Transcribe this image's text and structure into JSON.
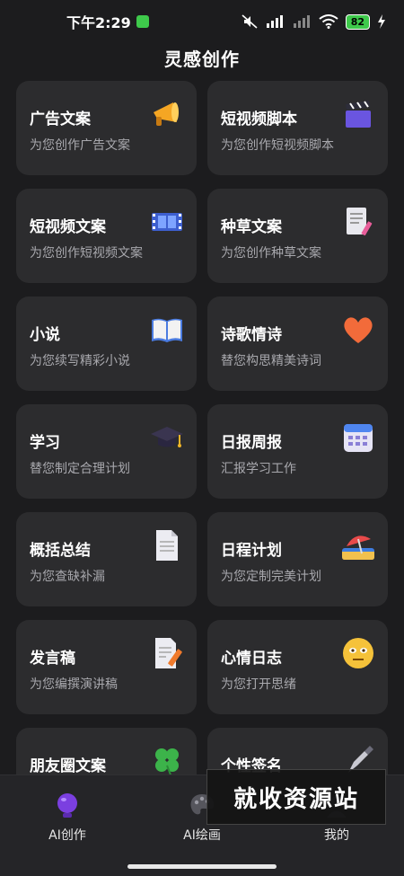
{
  "status_bar": {
    "time": "下午2:29",
    "battery": "82",
    "icons": [
      "mute-icon",
      "hd-signal-icon",
      "signal-icon",
      "wifi-icon",
      "battery-icon",
      "charging-icon"
    ]
  },
  "header": {
    "title": "灵感创作"
  },
  "cards": [
    {
      "title": "广告文案",
      "desc": "为您创作广告文案",
      "icon": "megaphone-icon"
    },
    {
      "title": "短视频脚本",
      "desc": "为您创作短视频脚本",
      "icon": "clapperboard-icon"
    },
    {
      "title": "短视频文案",
      "desc": "为您创作短视频文案",
      "icon": "film-strip-icon"
    },
    {
      "title": "种草文案",
      "desc": "为您创作种草文案",
      "icon": "document-pen-icon"
    },
    {
      "title": "小说",
      "desc": "为您续写精彩小说",
      "icon": "open-book-icon"
    },
    {
      "title": "诗歌情诗",
      "desc": "替您构思精美诗词",
      "icon": "heart-icon"
    },
    {
      "title": "学习",
      "desc": "替您制定合理计划",
      "icon": "graduation-cap-icon"
    },
    {
      "title": "日报周报",
      "desc": "汇报学习工作",
      "icon": "calendar-icon"
    },
    {
      "title": "概括总结",
      "desc": "为您查缺补漏",
      "icon": "page-icon"
    },
    {
      "title": "日程计划",
      "desc": "为您定制完美计划",
      "icon": "beach-umbrella-icon"
    },
    {
      "title": "发言稿",
      "desc": "为您编撰演讲稿",
      "icon": "memo-icon"
    },
    {
      "title": "心情日志",
      "desc": "为您打开思绪",
      "icon": "face-icon"
    },
    {
      "title": "朋友圈文案",
      "desc": "",
      "icon": "clover-icon"
    },
    {
      "title": "个性签名",
      "desc": "",
      "icon": "fountain-pen-icon"
    }
  ],
  "bottom_nav": {
    "items": [
      {
        "label": "AI创作",
        "icon": "bulb-icon"
      },
      {
        "label": "AI绘画",
        "icon": "palette-icon"
      },
      {
        "label": "我的",
        "icon": "profile-icon"
      }
    ]
  },
  "watermark": "就收资源站",
  "colors": {
    "background": "#1c1c1e",
    "card": "#2c2c2e",
    "secondary_text": "#a8a8ad",
    "accent_purple": "#7b3fe0"
  }
}
